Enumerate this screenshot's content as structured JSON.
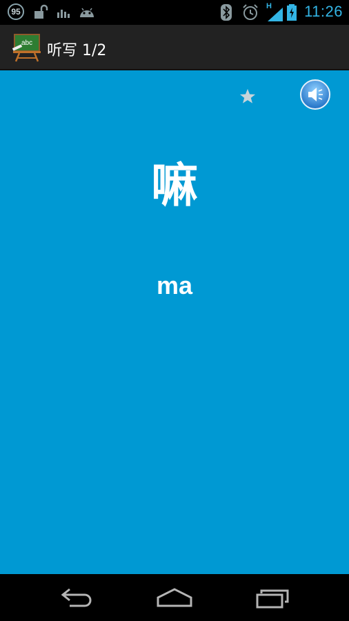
{
  "status_bar": {
    "notification_count": "95",
    "network_type": "H",
    "time": "11:26"
  },
  "action_bar": {
    "title": "听写 1/2",
    "app_icon": "chalkboard-abc-icon",
    "app_icon_text": "abc"
  },
  "card": {
    "character": "嘛",
    "pinyin": "ma"
  },
  "colors": {
    "background": "#0099d3",
    "status_accent": "#33b5e5",
    "action_bar": "#222222"
  },
  "icons": {
    "favorite": "star-icon",
    "audio": "speaker-icon",
    "back": "back-icon",
    "home": "home-icon",
    "recents": "recent-apps-icon"
  }
}
